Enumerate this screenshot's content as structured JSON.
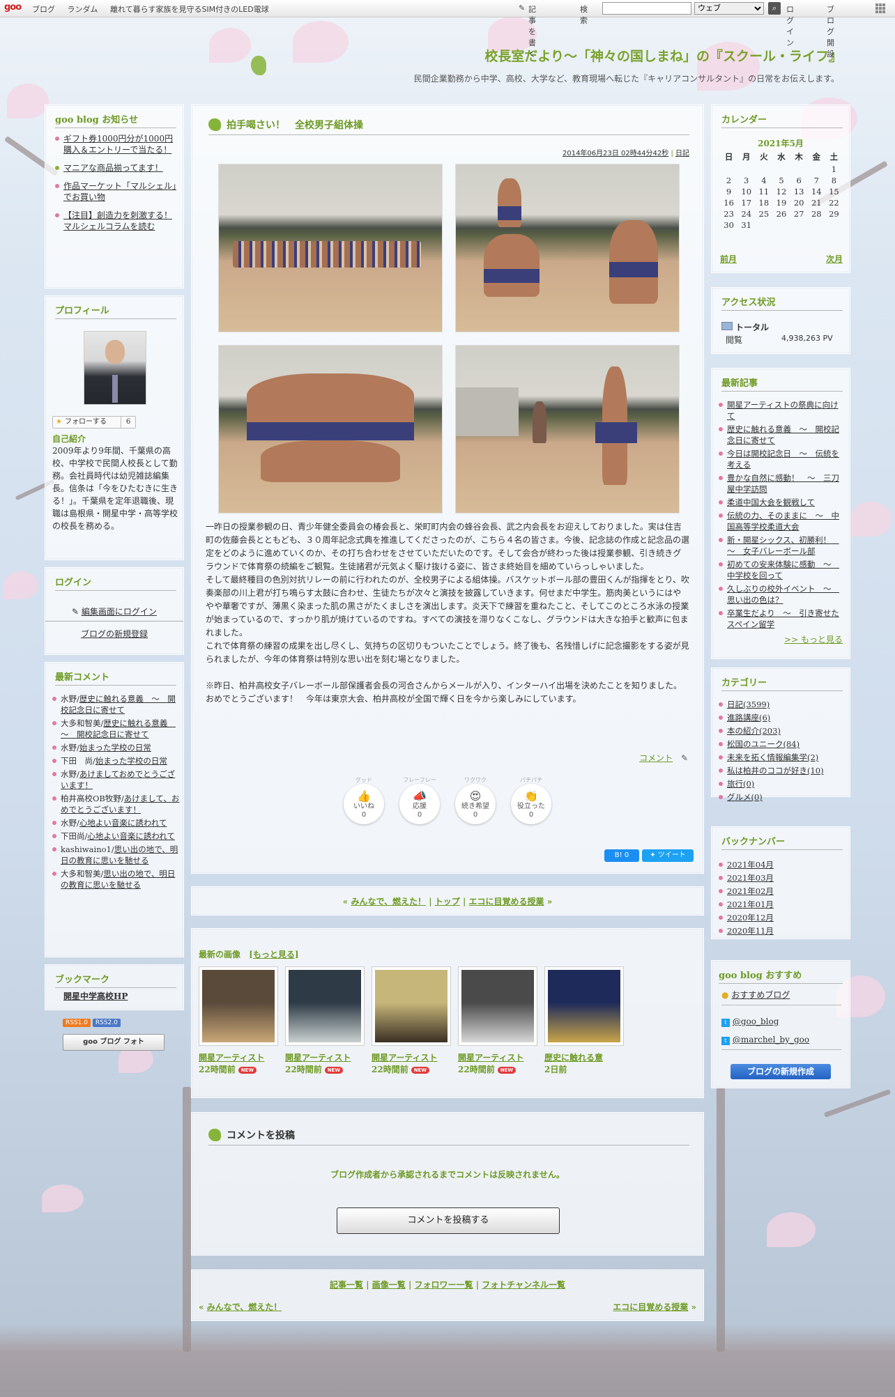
{
  "topbar": {
    "logo": "goo",
    "nav": [
      "ブログ",
      "ランダム",
      "離れて暮らす家族を見守るSIM付きのLED電球"
    ],
    "write_label": "記事を書く",
    "search_label": "検索",
    "search_placeholder": "",
    "search_scope": "ウェブ",
    "login": "ログイン",
    "open_blog": "ブログ開設"
  },
  "header": {
    "title": "校長室だより～「神々の国しまね」の『スクール・ライフ』",
    "description": "民間企業勤務から中学、高校、大学など、教育現場へ転じた『キャリアコンサルタント』の日常をお伝えします。"
  },
  "notices": {
    "title": "goo blog お知らせ",
    "items": [
      "ギフト券1000円分が1000円購入＆エントリーで当たる！",
      "マニアな商品揃ってます！",
      "作品マーケット「マルシェル」でお買い物",
      "【注目】創造力を刺激する！マルシェルコラムを読む"
    ]
  },
  "profile": {
    "title": "プロフィール",
    "follow": "フォローする",
    "follow_count": "6",
    "intro_heading": "自己紹介",
    "intro": "2009年より9年間、千葉県の高校、中学校で民間人校長として勤務。会社員時代は幼児雑誌編集長。信条は「今をひたむきに生きる！」。千葉県を定年退職後、現職は島根県・開星中学・高等学校の校長を務める。"
  },
  "login_box": {
    "title": "ログイン",
    "edit": "編集画面にログイン",
    "register": "ブログの新規登録"
  },
  "recent_comments": {
    "title": "最新コメント",
    "items": [
      {
        "who": "水野/",
        "what": "歴史に触れる意義　～　開校記念日に寄せて"
      },
      {
        "who": "大多和智美/",
        "what": "歴史に触れる意義　～　開校記念日に寄せて"
      },
      {
        "who": "水野/",
        "what": "始まった学校の日常"
      },
      {
        "who": "下田　尚/",
        "what": "始まった学校の日常"
      },
      {
        "who": "水野/",
        "what": "あけましておめでとうございます！"
      },
      {
        "who": "柏井高校OB牧野/",
        "what": "あけまして、おめでとうございます！"
      },
      {
        "who": "水野/",
        "what": "心地よい音楽に誘われて"
      },
      {
        "who": "下田尚/",
        "what": "心地よい音楽に誘われて"
      },
      {
        "who": "kashiwaino1/",
        "what": "思い出の地で、明日の教育に思いを馳せる"
      },
      {
        "who": "大多和智美/",
        "what": "思い出の地で、明日の教育に思いを馳せる"
      }
    ]
  },
  "bookmark": {
    "title": "ブックマーク",
    "item": "開星中学高校HP"
  },
  "rss": {
    "rss1": "RSS1.0",
    "rss2": "RSS2.0",
    "goo_photo": "goo ブログ フォト"
  },
  "post": {
    "title": "拍手喝さい！　全校男子組体操",
    "meta_date": "2014年06月23日 02時44分42秒",
    "meta_sep": "|",
    "meta_category": "日記",
    "paragraphs": [
      "一昨日の授業参観の日、青少年健全委員会の椿会長と、栄町町内会の蜂谷会長、武之内会長をお迎えしておりました。実は住吉町の佐藤会長とともども、３０周年記念式典を推進してくださったのが、こちら４名の皆さま。今後、記念誌の作成と記念品の選定をどのように進めていくのか、その打ち合わせをさせていただいたのです。そして会合が終わった後は授業参観、引き続きグラウンドで体育祭の続編をご観覧。生徒諸君が元気よく駆け抜ける姿に、皆さま終始目を細めていらっしゃいました。",
      "そして最終種目の色別対抗リレーの前に行われたのが、全校男子による組体操。バスケットボール部の豊田くんが指揮をとり、吹奏楽部の川上君が打ち鳴らす太鼓に合わせ、生徒たちが次々と演技を披露していきます。何せまだ中学生。筋肉美というにはややや華奢ですが、薄黒く染まった肌の黒さがたくましさを演出します。炎天下で練習を重ねたこと、そしてこのところ水泳の授業が始まっているので、すっかり肌が焼けているのですね。すべての演技を滞りなくこなし、グラウンドは大きな拍手と歓声に包まれました。",
      "これで体育祭の練習の成果を出し尽くし、気持ちの区切りもついたことでしょう。終了後も、名残惜しげに記念撮影をする姿が見られましたが、今年の体育祭は特別な思い出を刻む場となりました。",
      "",
      "※昨日、柏井高校女子バレーボール部保護者会長の河合さんからメールが入り、インターハイ出場を決めたことを知りました。おめでとうございます！　今年は東京大会、柏井高校が全国で輝く日を今から楽しみにしています。"
    ],
    "comment_link": "コメント",
    "reactions": [
      {
        "sup": "グッド",
        "icon": "👍",
        "label": "いいね",
        "count": "0"
      },
      {
        "sup": "フレーフレー",
        "icon": "📣",
        "label": "応援",
        "count": "0"
      },
      {
        "sup": "ワクワク",
        "icon": "😍",
        "label": "続き希望",
        "count": "0"
      },
      {
        "sup": "パチパチ",
        "icon": "👏",
        "label": "役立った",
        "count": "0"
      }
    ],
    "hatena": "B! 0",
    "tweet": "ツイート"
  },
  "post_nav": {
    "prev": "みんなで、燃えた！",
    "top": "トップ",
    "next": "エコに目覚める授業"
  },
  "latest_images": {
    "title": "最新の画像",
    "more": "[もっと見る]",
    "items": [
      {
        "caption": "開星アーティスト",
        "time": "22時間前",
        "new": "NEW",
        "c1": "#5a4a3a",
        "c2": "#c9a778"
      },
      {
        "caption": "開星アーティスト",
        "time": "22時間前",
        "new": "NEW",
        "c1": "#2e3a45",
        "c2": "#c9d0cf"
      },
      {
        "caption": "開星アーティスト",
        "time": "22時間前",
        "new": "NEW",
        "c1": "#c7b67a",
        "c2": "#3a3024"
      },
      {
        "caption": "開星アーティスト",
        "time": "22時間前",
        "new": "NEW",
        "c1": "#4a4a4a",
        "c2": "#d8d8d8"
      },
      {
        "caption": "歴史に触れる意",
        "time": "2日前",
        "new": "",
        "c1": "#1d2a5a",
        "c2": "#c9a54a"
      }
    ]
  },
  "comment_form": {
    "title": "コメントを投稿",
    "notice": "ブログ作成者から承認されるまでコメントは反映されません。",
    "button": "コメントを投稿する"
  },
  "footer_nav": {
    "links": [
      "記事一覧",
      "画像一覧",
      "フォロワー一覧",
      "フォトチャンネル一覧"
    ],
    "prev": "みんなで、燃えた！",
    "next": "エコに目覚める授業"
  },
  "calendar": {
    "title": "カレンダー",
    "month": "2021年5月",
    "weekdays": [
      "日",
      "月",
      "火",
      "水",
      "木",
      "金",
      "土"
    ],
    "weeks": [
      [
        "",
        "",
        "",
        "",
        "",
        "",
        "1"
      ],
      [
        "2",
        "3",
        "4",
        "5",
        "6",
        "7",
        "8"
      ],
      [
        "9",
        "10",
        "11",
        "12",
        "13",
        "14",
        "15"
      ],
      [
        "16",
        "17",
        "18",
        "19",
        "20",
        "21",
        "22"
      ],
      [
        "23",
        "24",
        "25",
        "26",
        "27",
        "28",
        "29"
      ],
      [
        "30",
        "31",
        "",
        "",
        "",
        "",
        ""
      ]
    ],
    "prev": "前月",
    "next": "次月"
  },
  "access": {
    "title": "アクセス状況",
    "total_label": "トータル",
    "views_label": "閲覧",
    "views": "4,938,263 PV"
  },
  "recent_posts": {
    "title": "最新記事",
    "items": [
      "開星アーティストの祭典に向けて",
      "歴史に触れる意義　～　開校記念日に寄せて",
      "今日は開校記念日　～　伝統を考える",
      "豊かな自然に感動！　～　三刀屋中学訪問",
      "柔道中国大会を観戦して",
      "伝統の力、そのままに　～　中国高等学校柔道大会",
      "新・開星シックス、初勝利！　～　女子バレーボール部",
      "初めての安来体験に感動　～　中学校を回って",
      "久しぶりの校外イベント　～　思い出の色は？",
      "卒業生だより　～　引き寄せたスペイン留学"
    ],
    "more": ">> もっと見る"
  },
  "categories": {
    "title": "カテゴリー",
    "items": [
      "日記(3599)",
      "進路講座(6)",
      "本の紹介(203)",
      "松国のユニーク(84)",
      "未来を拓く情報編集学(2)",
      "私は柏井のココが好き(10)",
      "旅行(0)",
      "グルメ(0)"
    ]
  },
  "backnumber": {
    "title": "バックナンバー",
    "items": [
      "2021年04月",
      "2021年03月",
      "2021年02月",
      "2021年01月",
      "2020年12月",
      "2020年11月"
    ]
  },
  "recommend": {
    "title": "goo blog おすすめ",
    "blog": "おすすめブログ",
    "tw1": "@goo_blog",
    "tw2": "@marchel_by_goo",
    "create": "ブログの新規作成"
  }
}
